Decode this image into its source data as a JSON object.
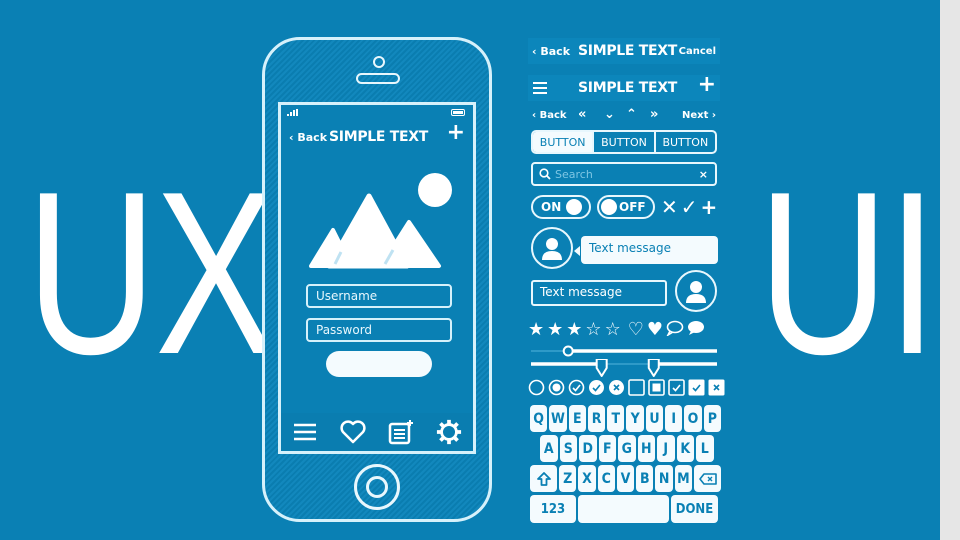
{
  "banner": {
    "left_text": "UX",
    "right_text": "UI",
    "colors": {
      "background": "#0a80b4",
      "foreground": "#ffffff",
      "side_strip": "#e6e6e6"
    }
  },
  "phone": {
    "nav": {
      "back_label": "Back",
      "title": "SIMPLE TEXT",
      "action_icon": "plus-icon"
    },
    "image_icon": "mountains-sun-icon",
    "username_placeholder": "Username",
    "password_placeholder": "Password",
    "login_label": "",
    "tabbar": [
      {
        "icon": "menu-icon"
      },
      {
        "icon": "heart-icon"
      },
      {
        "icon": "notes-icon"
      },
      {
        "icon": "gear-icon"
      }
    ]
  },
  "kit": {
    "nav1": {
      "back_label": "Back",
      "title": "SIMPLE TEXT",
      "cancel_label": "Cancel"
    },
    "nav2": {
      "menu_icon": "menu-icon",
      "title": "SIMPLE TEXT",
      "action": "+"
    },
    "nav3": {
      "back_label": "Back",
      "next_label": "Next"
    },
    "segmented": [
      "BUTTON",
      "BUTTON",
      "BUTTON"
    ],
    "search": {
      "placeholder": "Search",
      "clear": "×"
    },
    "toggle_on": "ON",
    "toggle_off": "OFF",
    "marks": [
      "✕",
      "✓",
      "+"
    ],
    "message_in": "Text message",
    "message_out": "Text message",
    "rating": {
      "filled": 3,
      "total": 5
    },
    "slider1_value": 0.2,
    "slider2_values": [
      0.38,
      0.66
    ],
    "keyboard": {
      "row1": [
        "Q",
        "W",
        "E",
        "R",
        "T",
        "Y",
        "U",
        "I",
        "O",
        "P"
      ],
      "row2": [
        "A",
        "S",
        "D",
        "F",
        "G",
        "H",
        "J",
        "K",
        "L"
      ],
      "row3": [
        "Z",
        "X",
        "C",
        "V",
        "B",
        "N",
        "M"
      ],
      "numbers_label": "123",
      "done_label": "DONE"
    }
  }
}
